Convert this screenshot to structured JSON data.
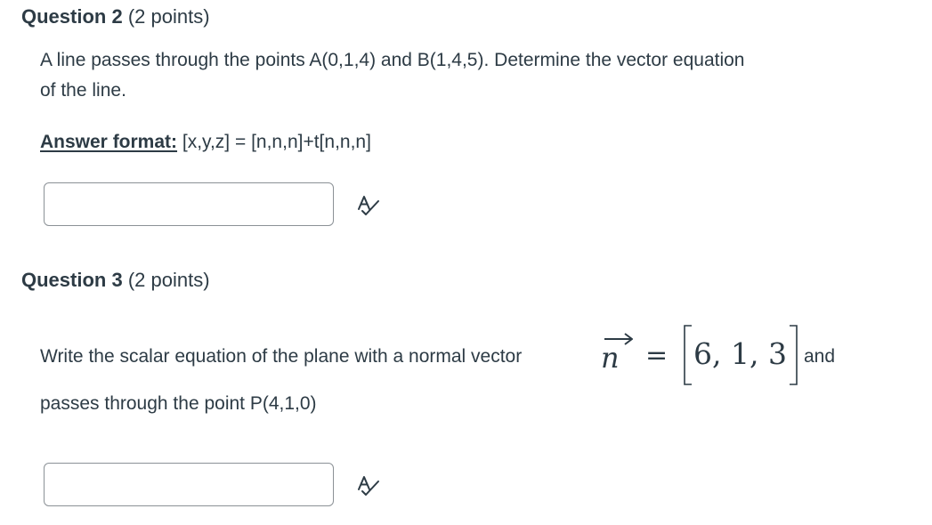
{
  "question2": {
    "number": "Question 2",
    "points": "(2 points)",
    "text_line1": "A line passes through the points A(0,1,4) and B(1,4,5). Determine the vector equation",
    "text_line2": "of the line.",
    "answer_format_label": "Answer format:",
    "answer_format_value": " [x,y,z] = [n,n,n]+t[n,n,n]",
    "answer_value": "",
    "spellcheck_icon": "spellcheck-icon"
  },
  "question3": {
    "number": "Question 3",
    "points": "(2 points)",
    "text_lead": "Write the scalar equation of the plane with a normal vector",
    "vector_symbol": "n",
    "equals": "=",
    "vector_value": "6, 1, 3",
    "text_trail": "and",
    "text_line2": "passes through the point P(4,1,0)",
    "answer_value": "",
    "spellcheck_icon": "spellcheck-icon"
  },
  "colors": {
    "text": "#2d3b45",
    "input_border": "#8b9196"
  }
}
